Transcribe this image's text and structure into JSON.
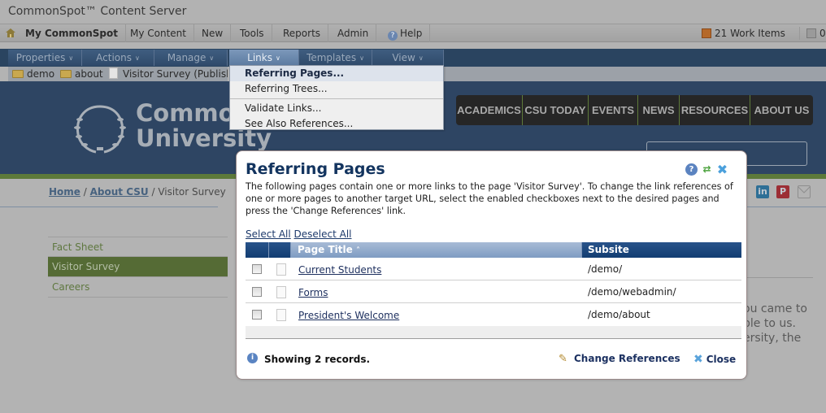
{
  "app": {
    "title": "CommonSpot™ Content Server"
  },
  "topnav": {
    "items": [
      {
        "label": "My CommonSpot"
      },
      {
        "label": "My Content"
      },
      {
        "label": "New"
      },
      {
        "label": "Tools"
      },
      {
        "label": "Reports"
      },
      {
        "label": "Admin"
      },
      {
        "label": "Help"
      }
    ],
    "work_items": "21 Work Items",
    "count_label": "0"
  },
  "pagebar": {
    "menus": [
      {
        "label": "Properties"
      },
      {
        "label": "Actions"
      },
      {
        "label": "Manage"
      },
      {
        "label": "Links"
      },
      {
        "label": "Templates"
      },
      {
        "label": "View"
      }
    ],
    "crumbs": [
      {
        "label": "demo"
      },
      {
        "label": "about"
      },
      {
        "label": "Visitor Survey (Published)"
      }
    ]
  },
  "links_menu": {
    "items": [
      {
        "label": "Referring Pages..."
      },
      {
        "label": "Referring Trees..."
      },
      {
        "label": "Validate Links..."
      },
      {
        "label": "See Also References..."
      }
    ]
  },
  "site": {
    "logo_line1": "Commo",
    "logo_line2": "University",
    "nav": [
      "ACADEMICS",
      "CSU TODAY",
      "EVENTS",
      "NEWS",
      "RESOURCES",
      "ABOUT US"
    ],
    "breadcrumb": {
      "home": "Home",
      "about": "About CSU",
      "current": "Visitor Survey",
      "sep": "/"
    },
    "left_nav": [
      "Fact Sheet",
      "Visitor Survey",
      "Careers"
    ],
    "body_lines": [
      "ou came to",
      "ple to us.",
      "ersity, the"
    ],
    "social": {
      "linkedin": "in",
      "pinterest": "P"
    }
  },
  "dialog": {
    "title": "Referring Pages",
    "description": "The following pages contain one or more links to the page 'Visitor Survey'. To change the link references of one or more pages to another target URL, select the enabled checkboxes next to the desired pages and press the 'Change References' link.",
    "select_all": "Select All",
    "deselect_all": "Deselect All",
    "columns": {
      "title": "Page Title",
      "sort_indicator": "˄",
      "subsite": "Subsite"
    },
    "rows": [
      {
        "title": "Current Students",
        "subsite": "/demo/",
        "checked": false
      },
      {
        "title": "Forms",
        "subsite": "/demo/webadmin/",
        "checked": false
      },
      {
        "title": "President's Welcome",
        "subsite": "/demo/about",
        "checked": false
      }
    ],
    "status": "Showing 2 records.",
    "change_references": "Change References",
    "close": "Close"
  },
  "colors": {
    "header_blue": "#2e4563",
    "accent_green": "#5d7a3a",
    "dialog_title": "#13345f",
    "grid_header": "#123d72"
  }
}
